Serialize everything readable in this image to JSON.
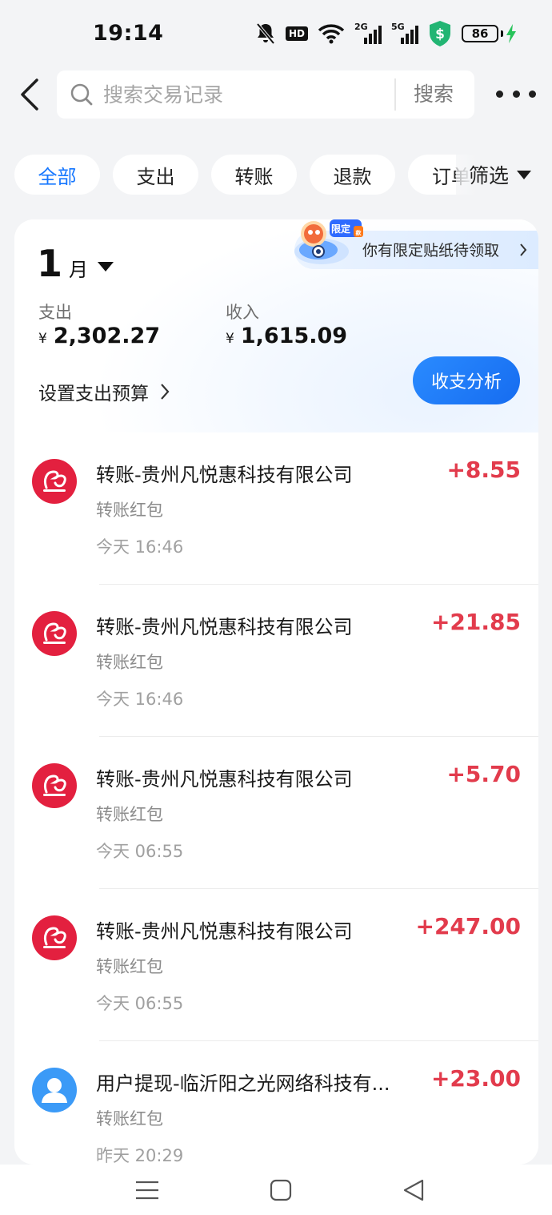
{
  "status_bar": {
    "time": "19:14",
    "hd_label": "HD",
    "signal_1_label": "2G",
    "signal_2_label": "5G",
    "battery_level": "86",
    "shield_color": "#22b573",
    "charging_color": "#27c35a"
  },
  "header": {
    "search_placeholder": "搜索交易记录",
    "search_button": "搜索",
    "back_icon": "chevron-left-icon",
    "more_icon": "more-horizontal-icon"
  },
  "filters": {
    "chips": [
      "全部",
      "支出",
      "转账",
      "退款",
      "订单"
    ],
    "active_index": 0,
    "filter_label": "筛选"
  },
  "summary": {
    "month_number": "1",
    "month_unit": "月",
    "promo_text": "你有限定贴纸待领取",
    "expense_label": "支出",
    "expense_currency": "¥",
    "expense_value": "2,302.27",
    "income_label": "收入",
    "income_currency": "¥",
    "income_value": "1,615.09",
    "budget_label": "设置支出预算",
    "analysis_button": "收支分析"
  },
  "transactions": [
    {
      "title": "转账-贵州凡悦惠科技有限公司",
      "subtitle": "转账红包",
      "time": "今天 16:46",
      "amount": "+8.55",
      "avatar": "brand-logo"
    },
    {
      "title": "转账-贵州凡悦惠科技有限公司",
      "subtitle": "转账红包",
      "time": "今天 16:46",
      "amount": "+21.85",
      "avatar": "brand-logo"
    },
    {
      "title": "转账-贵州凡悦惠科技有限公司",
      "subtitle": "转账红包",
      "time": "今天 06:55",
      "amount": "+5.70",
      "avatar": "brand-logo"
    },
    {
      "title": "转账-贵州凡悦惠科技有限公司",
      "subtitle": "转账红包",
      "time": "今天 06:55",
      "amount": "+247.00",
      "avatar": "brand-logo"
    },
    {
      "title": "用户提现-临沂阳之光网络科技有...",
      "subtitle": "转账红包",
      "time": "昨天 20:29",
      "amount": "+23.00",
      "avatar": "user-avatar"
    }
  ],
  "colors": {
    "accent": "#1677ff",
    "income_amount": "#e23b4c",
    "brand_avatar": "#e3203f"
  }
}
